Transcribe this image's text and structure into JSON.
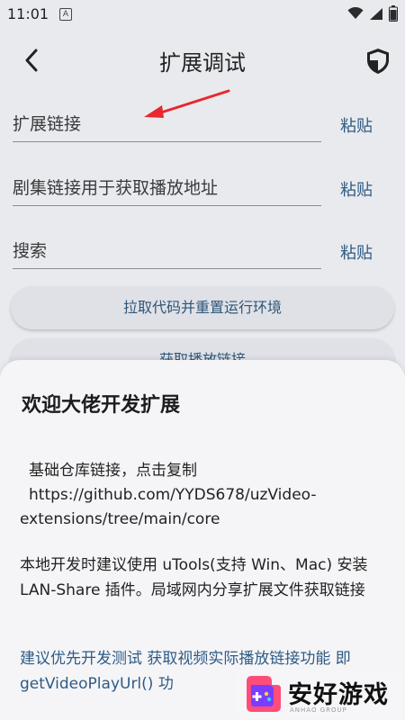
{
  "status_bar": {
    "time": "11:01",
    "notification_glyph": "A"
  },
  "header": {
    "title": "扩展调试"
  },
  "fields": [
    {
      "label": "扩展链接",
      "paste": "粘贴"
    },
    {
      "label": "剧集链接用于获取播放地址",
      "paste": "粘贴"
    },
    {
      "label": "搜索",
      "paste": "粘贴"
    }
  ],
  "buttons": {
    "pull_code": "拉取代码并重置运行环境",
    "get_play_link": "获取播放链接"
  },
  "sheet": {
    "title": "欢迎大佬开发扩展",
    "repo_label": "基础仓库链接，点击复制",
    "repo_url": "https://github.com/YYDS678/uzVideo-extensions/tree/main/core",
    "local_dev": "本地开发时建议使用 uTools(支持 Win、Mac) 安装 LAN-Share 插件。局域网内分享扩展文件获取链接",
    "recommend": "建议优先开发测试 获取视频实际播放链接功能 即 getVideoPlayUrl() 功"
  },
  "watermark": {
    "text": "安好游戏",
    "sub": "ANHAO GROUP"
  },
  "colors": {
    "accent": "#2e5b85",
    "arrow": "#e8272f",
    "background": "#e9eaee",
    "sheet": "#f5f5f7"
  }
}
